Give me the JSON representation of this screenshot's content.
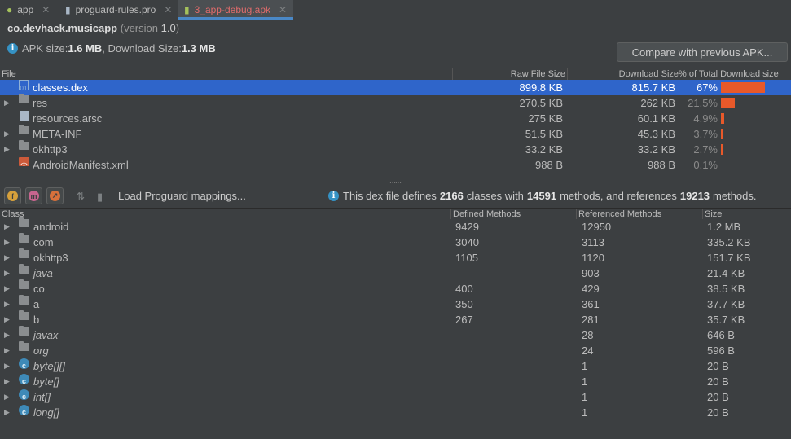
{
  "tabs": [
    {
      "label": "app",
      "icon": "android-icon"
    },
    {
      "label": "proguard-rules.pro",
      "icon": "file-icon"
    },
    {
      "label": "3_app-debug.apk",
      "icon": "apk-icon",
      "active": true
    }
  ],
  "header": {
    "package": "co.devhack.musicapp",
    "version_prefix": "(version ",
    "version": "1.0",
    "version_suffix": ")",
    "apk_size_label": "APK size: ",
    "apk_size": "1.6 MB",
    "download_size_label": ", Download Size: ",
    "download_size": "1.3 MB",
    "compare_button": "Compare with previous APK..."
  },
  "file_table": {
    "columns": [
      "File",
      "Raw File Size",
      "Download Size",
      "% of Total Download size"
    ],
    "rows": [
      {
        "name": "classes.dex",
        "raw": "899.8 KB",
        "download": "815.7 KB",
        "pct": "67%",
        "share": 0.67,
        "icon": "dex-icon",
        "expandable": false,
        "selected": true
      },
      {
        "name": "res",
        "raw": "270.5 KB",
        "download": "262 KB",
        "pct": "21.5%",
        "share": 0.215,
        "icon": "folder-icon",
        "expandable": true
      },
      {
        "name": "resources.arsc",
        "raw": "275 KB",
        "download": "60.1 KB",
        "pct": "4.9%",
        "share": 0.049,
        "icon": "file-icon",
        "expandable": false
      },
      {
        "name": "META-INF",
        "raw": "51.5 KB",
        "download": "45.3 KB",
        "pct": "3.7%",
        "share": 0.037,
        "icon": "folder-icon",
        "expandable": true
      },
      {
        "name": "okhttp3",
        "raw": "33.2 KB",
        "download": "33.2 KB",
        "pct": "2.7%",
        "share": 0.027,
        "icon": "folder-icon",
        "expandable": true
      },
      {
        "name": "AndroidManifest.xml",
        "raw": "988 B",
        "download": "988 B",
        "pct": "0.1%",
        "share": 0.001,
        "icon": "xml-icon",
        "expandable": false
      }
    ]
  },
  "toolbar": {
    "load_mappings": "Load Proguard mappings...",
    "dex_info": {
      "prefix": "This dex file defines",
      "classes": "2166",
      "mid1": "classes with",
      "methods": "14591",
      "mid2": "methods, and references",
      "references": "19213",
      "suffix": "methods."
    }
  },
  "class_table": {
    "columns": [
      "Class",
      "Defined Methods",
      "Referenced Methods",
      "Size"
    ],
    "rows": [
      {
        "name": "android",
        "defined": "9429",
        "referenced": "12950",
        "size": "1.2 MB",
        "kind": "package",
        "italic": false
      },
      {
        "name": "com",
        "defined": "3040",
        "referenced": "3113",
        "size": "335.2 KB",
        "kind": "package",
        "italic": false
      },
      {
        "name": "okhttp3",
        "defined": "1105",
        "referenced": "1120",
        "size": "151.7 KB",
        "kind": "package",
        "italic": false
      },
      {
        "name": "java",
        "defined": "",
        "referenced": "903",
        "size": "21.4 KB",
        "kind": "package",
        "italic": true
      },
      {
        "name": "co",
        "defined": "400",
        "referenced": "429",
        "size": "38.5 KB",
        "kind": "package",
        "italic": false
      },
      {
        "name": "a",
        "defined": "350",
        "referenced": "361",
        "size": "37.7 KB",
        "kind": "package",
        "italic": false
      },
      {
        "name": "b",
        "defined": "267",
        "referenced": "281",
        "size": "35.7 KB",
        "kind": "package",
        "italic": false
      },
      {
        "name": "javax",
        "defined": "",
        "referenced": "28",
        "size": "646 B",
        "kind": "package",
        "italic": true
      },
      {
        "name": "org",
        "defined": "",
        "referenced": "24",
        "size": "596 B",
        "kind": "package",
        "italic": true
      },
      {
        "name": "byte[][]",
        "defined": "",
        "referenced": "1",
        "size": "20 B",
        "kind": "class",
        "italic": true
      },
      {
        "name": "byte[]",
        "defined": "",
        "referenced": "1",
        "size": "20 B",
        "kind": "class",
        "italic": true
      },
      {
        "name": "int[]",
        "defined": "",
        "referenced": "1",
        "size": "20 B",
        "kind": "class",
        "italic": true
      },
      {
        "name": "long[]",
        "defined": "",
        "referenced": "1",
        "size": "20 B",
        "kind": "class",
        "italic": true
      }
    ]
  },
  "colors": {
    "background": "#3c3f41",
    "selection": "#2f65ca",
    "bar": "#e8592a",
    "accent": "#4a88c7"
  }
}
